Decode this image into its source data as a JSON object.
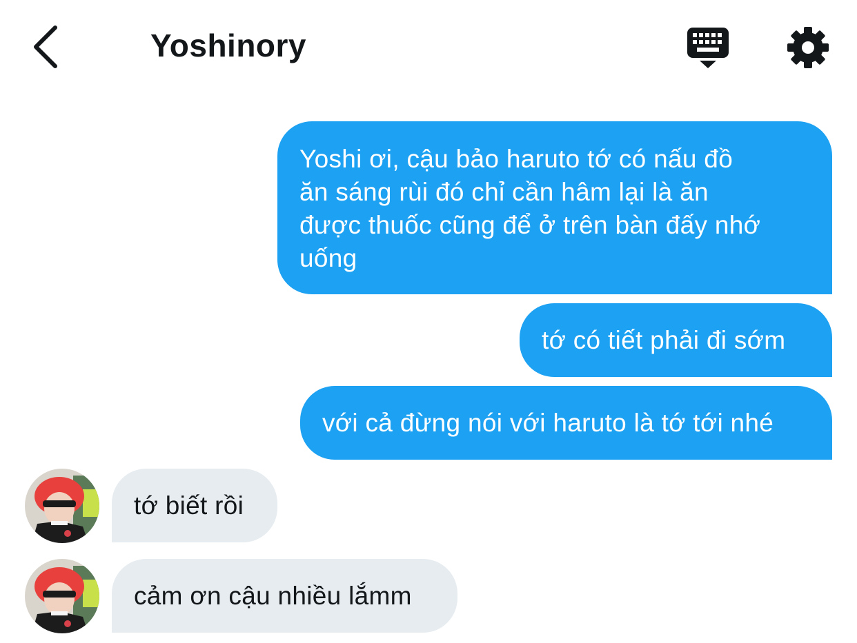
{
  "header": {
    "title": "Yoshinory",
    "back_icon": "chevron-left-icon",
    "keyboard_icon": "keyboard-icon",
    "settings_icon": "gear-icon"
  },
  "colors": {
    "outgoing_bubble": "#1da1f2",
    "incoming_bubble": "#e6ecf0",
    "text_dark": "#14171a"
  },
  "messages": [
    {
      "direction": "outgoing",
      "text": "Yoshi ơi, cậu bảo haruto tớ có nấu đồ ăn sáng rùi đó chỉ cần hâm lại là ăn được thuốc cũng để ở trên bàn đấy nhớ uống",
      "lines": [
        "Yoshi ơi, cậu bảo haruto tớ có nấu đồ",
        "ăn sáng rùi đó chỉ cần hâm lại là ăn",
        "được thuốc cũng để ở trên bàn đấy nhớ",
        "uống"
      ]
    },
    {
      "direction": "outgoing",
      "text": "tớ có tiết phải đi sớm"
    },
    {
      "direction": "outgoing",
      "text": "với cả đừng nói với haruto là tớ tới nhé"
    },
    {
      "direction": "incoming",
      "text": "tớ biết rồi"
    },
    {
      "direction": "incoming",
      "text": "cảm ơn cậu nhiều lắmm"
    }
  ]
}
